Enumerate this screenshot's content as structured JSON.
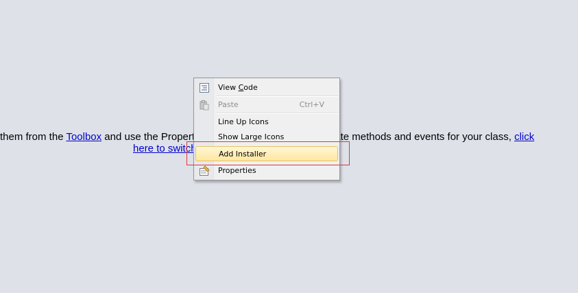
{
  "designer": {
    "line1_part1": "them from the ",
    "toolbox_link": "Toolbox",
    "line1_part2": " and use the Properti",
    "line1_part3": "To create methods and events for your class, ",
    "click_link": "click",
    "line2_link": "here to switch"
  },
  "context_menu": {
    "items": [
      {
        "label": "View Code",
        "mnemonic": "C",
        "icon": "view-code-icon",
        "enabled": true
      },
      {
        "label": "Paste",
        "shortcut": "Ctrl+V",
        "icon": "paste-icon",
        "enabled": false
      },
      {
        "label": "Line Up Icons",
        "enabled": true
      },
      {
        "label": "Show Large Icons",
        "enabled": true
      },
      {
        "label": "Add Installer",
        "enabled": true,
        "highlighted": true
      },
      {
        "label": "Properties",
        "icon": "properties-icon",
        "enabled": true
      }
    ]
  },
  "colors": {
    "background": "#dee1e8",
    "link": "#0000cc",
    "highlight_outline": "#e0353b",
    "menu_hover": "#ffe7a0"
  }
}
